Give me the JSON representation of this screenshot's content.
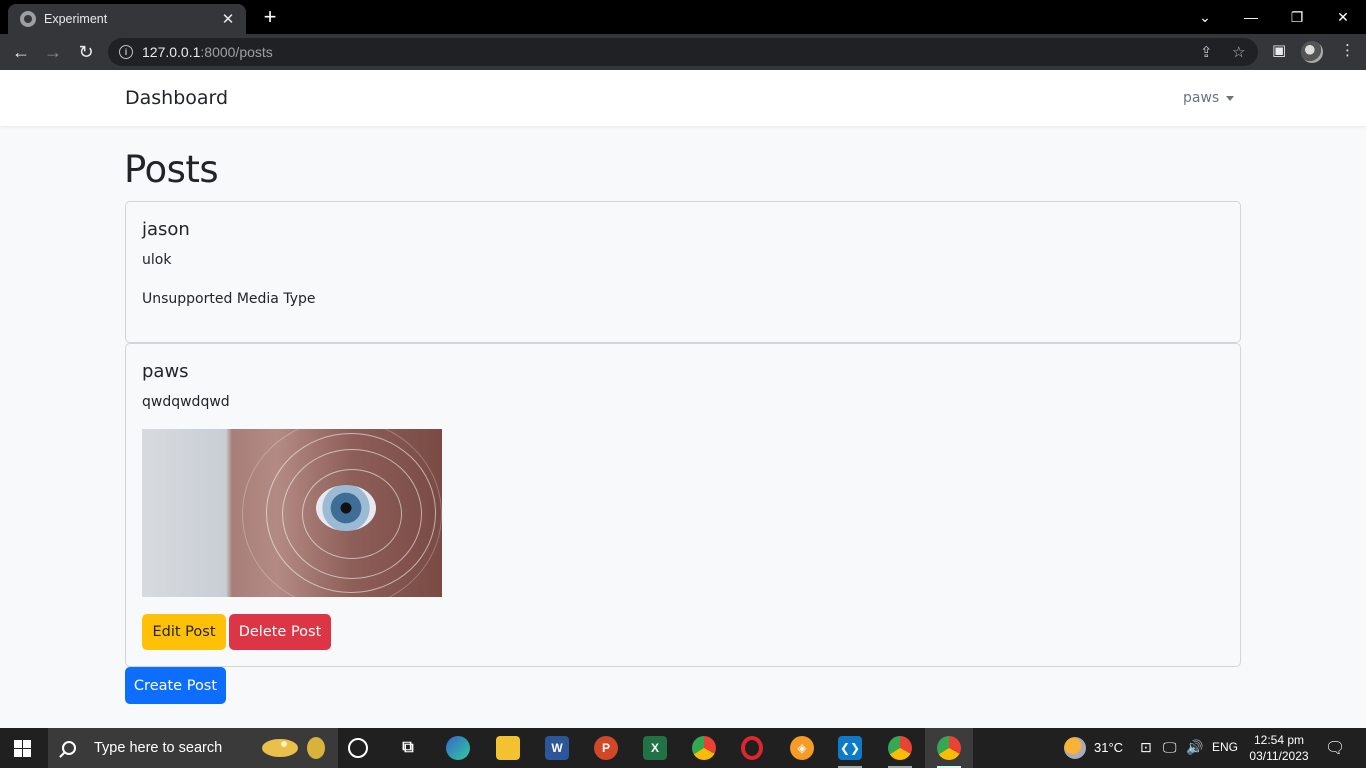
{
  "browser": {
    "tab_title": "Experiment",
    "url_host": "127.0.0.1",
    "url_path": ":8000/posts"
  },
  "navbar": {
    "brand": "Dashboard",
    "user": "paws"
  },
  "page": {
    "title": "Posts",
    "posts": [
      {
        "author": "jason",
        "body": "ulok",
        "media_text": "Unsupported Media Type"
      },
      {
        "author": "paws",
        "body": "qwdqwdqwd",
        "image": "eye-scan-photo"
      }
    ],
    "edit_label": "Edit Post",
    "delete_label": "Delete Post",
    "create_label": "Create Post"
  },
  "taskbar": {
    "search_placeholder": "Type here to search",
    "weather": "31°C",
    "language": "ENG",
    "time": "12:54 pm",
    "date": "03/11/2023"
  },
  "colors": {
    "primary": "#0d6efd",
    "warning": "#ffc107",
    "danger": "#dc3545"
  }
}
